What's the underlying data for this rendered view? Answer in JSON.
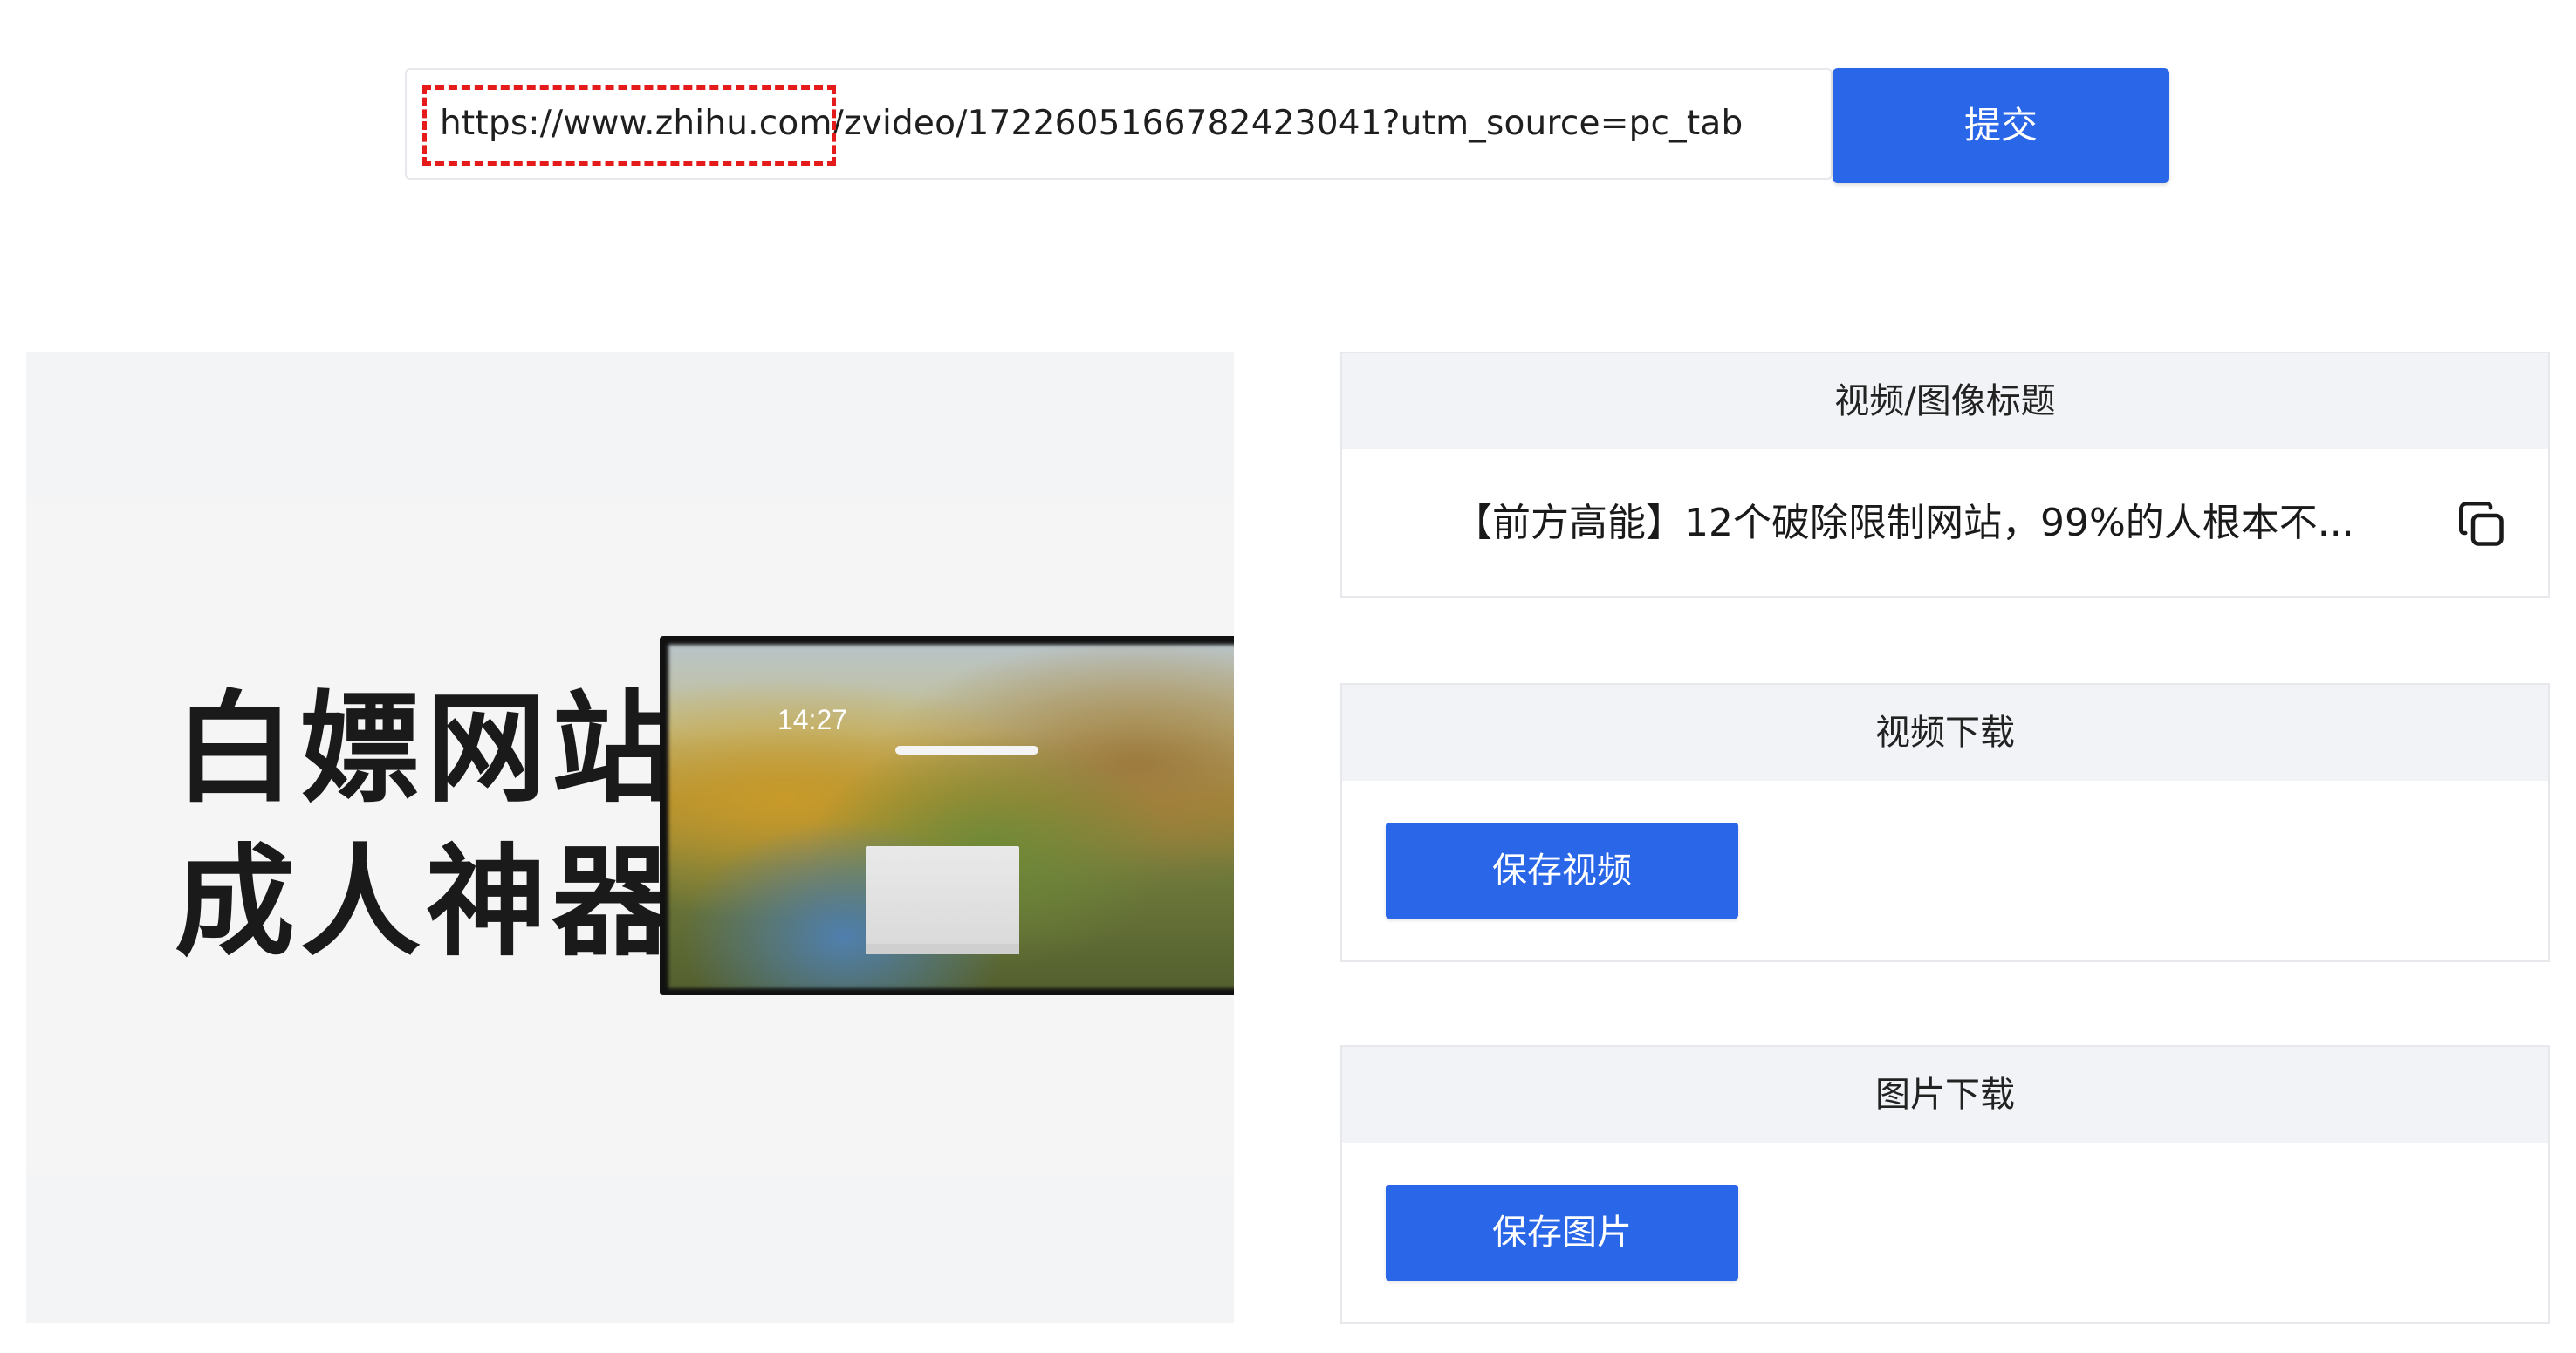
{
  "url_input": {
    "value": "https://www.zhihu.com/zvideo/1722605166782423041?utm_source=pc_tab"
  },
  "submit_label": "提交",
  "preview": {
    "poster_line1": "白嫖网站",
    "poster_line2": "成人神器",
    "screen_time": "14:27"
  },
  "title_panel": {
    "header": "视频/图像标题",
    "title": "【前方高能】12个破除限制网站，99%的人根本不...",
    "copy_icon": "copy-icon"
  },
  "video_panel": {
    "header": "视频下载",
    "button": "保存视频"
  },
  "image_panel": {
    "header": "图片下载",
    "button": "保存图片"
  },
  "colors": {
    "primary": "#2a66e8",
    "highlight": "#e51b1b",
    "panel_header_bg": "#f1f3f6"
  }
}
